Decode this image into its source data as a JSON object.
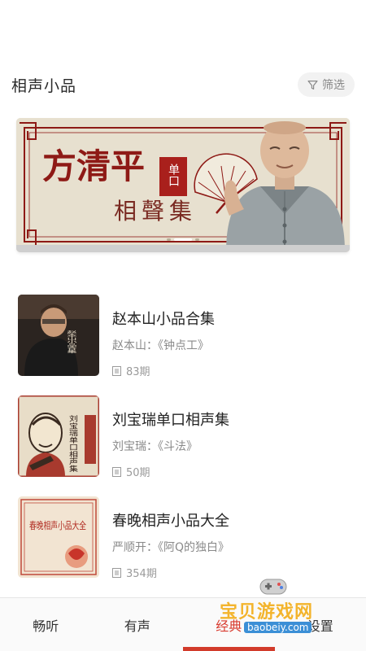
{
  "header": {
    "title": "相声小品",
    "filter_label": "筛选"
  },
  "banner": {
    "heading_main": "方清平",
    "stamp": "单口",
    "subtitle": "相聲集",
    "slide_count": 3,
    "active_slide": 1
  },
  "albums": [
    {
      "title": "赵本山小品合集",
      "subtitle": "赵本山：《钟点工》",
      "episodes": "83期",
      "cover_text": "赵本山小品合集"
    },
    {
      "title": "刘宝瑞单口相声集",
      "subtitle": "刘宝瑞：《斗法》",
      "episodes": "50期",
      "cover_text": "刘宝瑞单口相声集"
    },
    {
      "title": "春晚相声小品大全",
      "subtitle": "严顺开：《阿Q的独白》",
      "episodes": "354期",
      "cover_text": "春晚相声小品大全"
    }
  ],
  "tabs": [
    {
      "label": "畅听"
    },
    {
      "label": "有声"
    },
    {
      "label": "经典"
    },
    {
      "label": "设置"
    }
  ],
  "watermark": {
    "text": "宝贝游戏网",
    "url": "baobeiy.com"
  },
  "colors": {
    "accent": "#d23b2b",
    "banner_bg": "#e7e0cf",
    "banner_red": "#8e1a16"
  }
}
